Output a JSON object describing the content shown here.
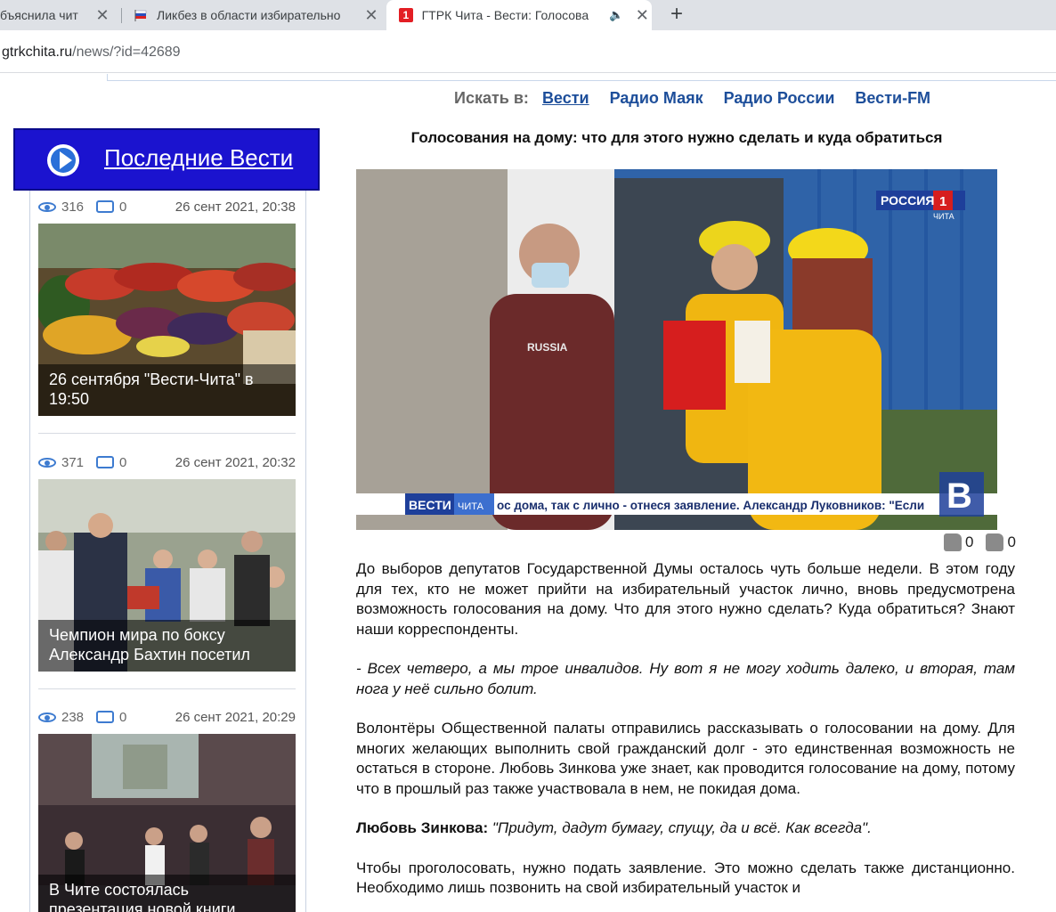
{
  "browser": {
    "tabs": [
      {
        "title": "бъяснила чит"
      },
      {
        "title": "Ликбез в области избирательно"
      },
      {
        "title": "ГТРК Чита - Вести: Голосова",
        "favicon": "1"
      }
    ],
    "url_host": "gtrkchita.ru",
    "url_rest": "/news/?id=42689"
  },
  "search": {
    "label": "Искать в:",
    "links": [
      "Вести",
      "Радио Маяк",
      "Радио России",
      "Вести-FM"
    ]
  },
  "sidebar": {
    "title": "Последние Вести",
    "items": [
      {
        "views": "316",
        "comments": "0",
        "date": "26 сент 2021, 20:38",
        "caption": "26 сентября \"Вести-Чита\" в 19:50"
      },
      {
        "views": "371",
        "comments": "0",
        "date": "26 сент 2021, 20:32",
        "caption": "Чемпион мира по боксу Александр Бахтин посетил"
      },
      {
        "views": "238",
        "comments": "0",
        "date": "26 сент 2021, 20:29",
        "caption": "В Чите состоялась презентация новой книги"
      }
    ]
  },
  "article": {
    "title": "Голосования на дому: что для этого нужно сделать и куда обратиться",
    "video": {
      "channel_logo": "РОССИЯ",
      "channel_num": "1",
      "channel_sub": "ЧИТА",
      "ticker_brand": "ВЕСТИ",
      "ticker_sub": "ЧИТА",
      "ticker_text": "ос дома, так с лично - отнеся заявление. Александр Луковников: \"Если",
      "corner_logo": "В",
      "shirt_text": "RUSSIA"
    },
    "likes": "0",
    "dislikes": "0",
    "paragraphs": {
      "p1": "До выборов депутатов Государственной Думы осталось чуть больше недели. В этом году для тех, кто не может прийти на избирательный участок лично, вновь предусмотрена возможность голосования на дому. Что для этого нужно сделать? Куда обратиться? Знают наши корреспонденты.",
      "p2": "- Всех четверо, а мы трое инвалидов. Ну вот я не могу ходить далеко, и вторая, там нога у неё сильно болит.",
      "p3": "Волонтёры Общественной палаты отправились рассказывать о голосовании на дому. Для многих желающих выполнить свой гражданский долг - это единственная возможность не остаться в стороне. Любовь Зинкова уже знает, как проводится голосование на дому, потому что в прошлый раз также участвовала в нем, не покидая дома.",
      "p4_speaker": "Любовь Зинкова:",
      "p4_quote": "\"Придут, дадут бумагу, спущу, да и всё. Как всегда\".",
      "p5": "Чтобы проголосовать, нужно подать заявление. Это можно сделать также дистанционно. Необходимо лишь позвонить на свой избирательный участок и"
    }
  }
}
